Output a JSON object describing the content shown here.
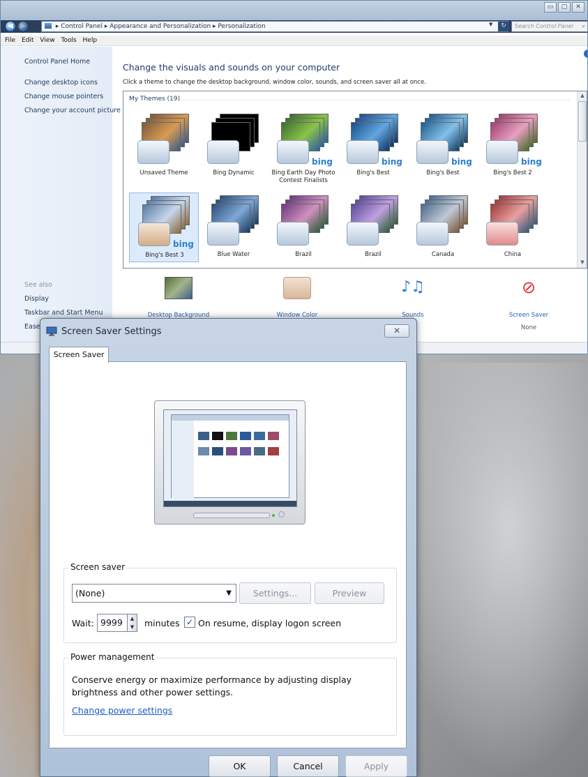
{
  "control_panel": {
    "breadcrumb": [
      "Control Panel",
      "Appearance and Personalization",
      "Personalization"
    ],
    "search_placeholder": "Search Control Panel",
    "menu": [
      "File",
      "Edit",
      "View",
      "Tools",
      "Help"
    ],
    "sidebar": {
      "home": "Control Panel Home",
      "links": [
        "Change desktop icons",
        "Change mouse pointers",
        "Change your account picture"
      ],
      "see_also_label": "See also",
      "see_also": [
        "Display",
        "Taskbar and Start Menu",
        "Ease of Access Center"
      ]
    },
    "title": "Change the visuals and sounds on your computer",
    "description": "Click a theme to change the desktop background, window color, sounds, and screen saver all at once.",
    "themes_header": "My Themes (19)",
    "themes": [
      {
        "label": "Unsaved Theme",
        "bing": ""
      },
      {
        "label": "Bing Dynamic",
        "bing": ""
      },
      {
        "label": "Bing Earth Day Photo Contest Finalists",
        "bing": "bing"
      },
      {
        "label": "Bing's Best",
        "bing": "bing"
      },
      {
        "label": "Bing's Best",
        "bing": "bing"
      },
      {
        "label": "Bing's Best 2",
        "bing": "bing"
      },
      {
        "label": "Bing's Best 3",
        "bing": "bing"
      },
      {
        "label": "Blue Water",
        "bing": ""
      },
      {
        "label": "Brazil",
        "bing": ""
      },
      {
        "label": "Brazil",
        "bing": ""
      },
      {
        "label": "Canada",
        "bing": ""
      },
      {
        "label": "China",
        "bing": ""
      }
    ],
    "bottom_items": [
      {
        "label": "Desktop Background",
        "sub": ""
      },
      {
        "label": "Window Color",
        "sub": ""
      },
      {
        "label": "Sounds",
        "sub": ""
      },
      {
        "label": "Screen Saver",
        "sub": "None"
      }
    ]
  },
  "dialog": {
    "title": "Screen Saver Settings",
    "close_glyph": "✕",
    "tab": "Screen Saver",
    "screen_saver_group": "Screen saver",
    "selected_saver": "(None)",
    "settings_button": "Settings...",
    "preview_button": "Preview",
    "wait_label": "Wait:",
    "wait_value": "9999",
    "minutes_label": "minutes",
    "resume_checked": true,
    "resume_label": "On resume, display logon screen",
    "power_group": "Power management",
    "power_text": "Conserve energy or maximize performance by adjusting display brightness and other power settings.",
    "power_link": "Change power settings",
    "ok_button": "OK",
    "cancel_button": "Cancel",
    "apply_button": "Apply"
  }
}
